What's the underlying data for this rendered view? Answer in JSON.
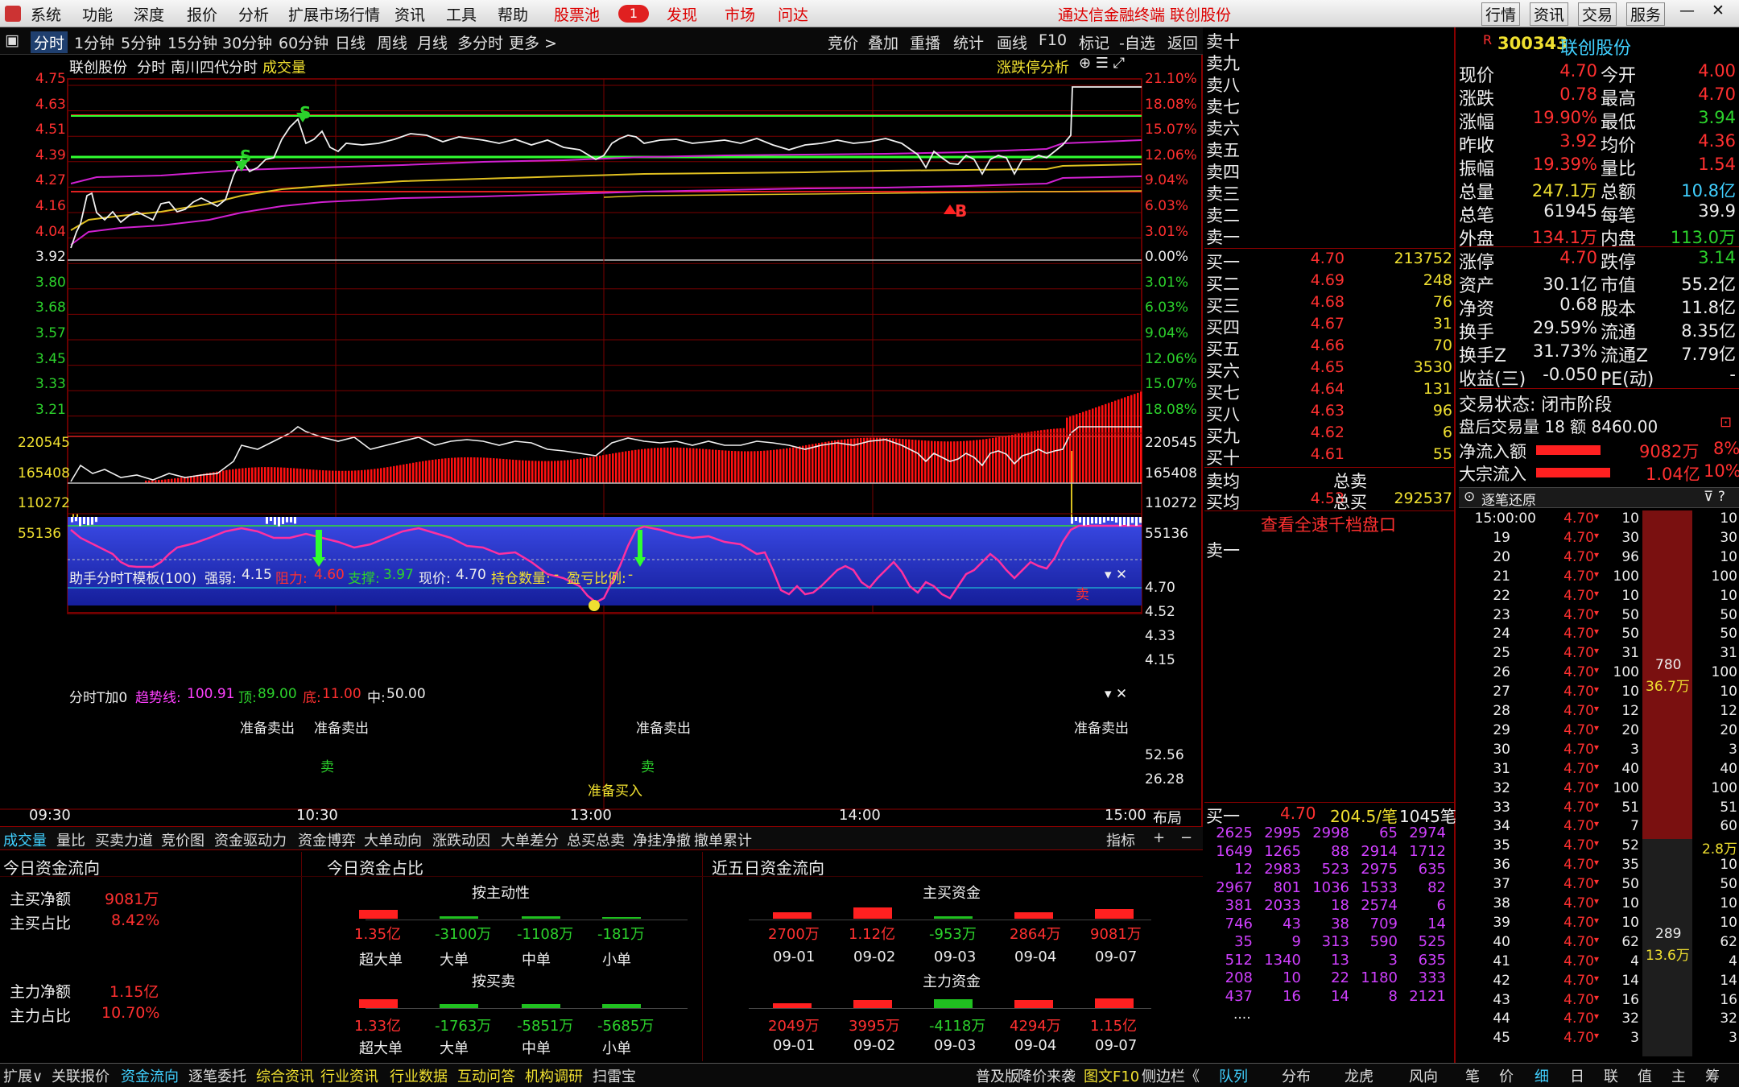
{
  "menu": {
    "items": [
      "系统",
      "功能",
      "深度",
      "报价",
      "分析",
      "扩展市场行情",
      "资讯",
      "工具",
      "帮助"
    ],
    "stock_pool": "股票池",
    "badge": "1",
    "discover": "发现",
    "market": "市场",
    "ask": "问达",
    "title": "通达信金融终端  联创股份",
    "right_tabs": [
      "行情",
      "资讯",
      "交易",
      "服务"
    ]
  },
  "periods": {
    "items": [
      "分时",
      "1分钟",
      "5分钟",
      "15分钟",
      "30分钟",
      "60分钟",
      "日线",
      "周线",
      "月线",
      "多分时",
      "更多 >"
    ],
    "tools": [
      "竞价",
      "叠加",
      "重播",
      "统计",
      "画线",
      "F10",
      "标记",
      "-自选",
      "返回"
    ]
  },
  "chart_header": {
    "name": "联创股份",
    "mode": "分时",
    "indicator": "南川四代分时",
    "volume": "成交量",
    "analysis": "涨跌停分析"
  },
  "price_axis": {
    "left": [
      "4.75",
      "4.63",
      "4.51",
      "4.39",
      "4.27",
      "4.16",
      "4.04",
      "3.92",
      "3.80",
      "3.68",
      "3.57",
      "3.45",
      "3.33",
      "3.21"
    ],
    "right": [
      "21.10%",
      "18.08%",
      "15.07%",
      "12.06%",
      "9.04%",
      "6.03%",
      "3.01%",
      "0.00%",
      "3.01%",
      "6.03%",
      "9.04%",
      "12.06%",
      "15.07%",
      "18.08%"
    ]
  },
  "volume_axis": [
    "220545",
    "165408",
    "110272",
    "55136"
  ],
  "markers": {
    "s1": "S",
    "s2": "S",
    "b": "B"
  },
  "ind1": {
    "title": "助手分时T模板(100)",
    "strength_label": "强弱:",
    "strength": "4.15",
    "resist_label": "阻力:",
    "resist": "4.60",
    "support_label": "支撑:",
    "support": "3.97",
    "price_label": "现价:",
    "price": "4.70",
    "hold_label": "持仓数量:",
    "hold": "-",
    "pnl_label": "盈亏比例:",
    "pnl": "-",
    "axis": [
      "4.70",
      "4.52",
      "4.33",
      "4.15"
    ],
    "sell": "卖"
  },
  "ind2": {
    "title": "分时T加0",
    "trend_label": "趋势线:",
    "trend": "100.91",
    "top_label": "顶:",
    "top": "89.00",
    "bottom_label": "底:",
    "bottom": "11.00",
    "mid_label": "中:",
    "mid": "50.00",
    "axis": [
      "52.56",
      "26.28"
    ],
    "prep_sell": "准备卖出",
    "prep_buy": "准备买入",
    "sell": "卖"
  },
  "time_axis": [
    "09:30",
    "10:30",
    "13:00",
    "14:00",
    "15:00"
  ],
  "layout_btn": "布局",
  "orderbook": {
    "asks": [
      "卖十",
      "卖九",
      "卖八",
      "卖七",
      "卖六",
      "卖五",
      "卖四",
      "卖三",
      "卖二",
      "卖一"
    ],
    "bids": [
      [
        "买一",
        "4.70",
        "213752"
      ],
      [
        "买二",
        "4.69",
        "248"
      ],
      [
        "买三",
        "4.68",
        "76"
      ],
      [
        "买四",
        "4.67",
        "31"
      ],
      [
        "买五",
        "4.66",
        "70"
      ],
      [
        "买六",
        "4.65",
        "3530"
      ],
      [
        "买七",
        "4.64",
        "131"
      ],
      [
        "买八",
        "4.63",
        "96"
      ],
      [
        "买九",
        "4.62",
        "6"
      ],
      [
        "买十",
        "4.61",
        "55"
      ]
    ],
    "avg_sell": "卖均",
    "total_sell": "总卖",
    "avg_buy": "买均",
    "avg_buy_val": "4.53",
    "total_buy": "总买",
    "total_buy_val": "292537",
    "fast_btn": "查看全速千档盘口",
    "sell1": "卖一",
    "buy1": "买一",
    "buy1_price": "4.70",
    "buy1_per": "204.5/笔",
    "buy1_count": "1045笔"
  },
  "queue": [
    [
      "2625",
      "2995",
      "2998",
      "65",
      "2974"
    ],
    [
      "1649",
      "1265",
      "88",
      "2914",
      "1712"
    ],
    [
      "12",
      "2983",
      "523",
      "2975",
      "635"
    ],
    [
      "2967",
      "801",
      "1036",
      "1533",
      "82"
    ],
    [
      "381",
      "2033",
      "18",
      "2574",
      "6"
    ],
    [
      "746",
      "43",
      "38",
      "709",
      "14"
    ],
    [
      "35",
      "9",
      "313",
      "590",
      "525"
    ],
    [
      "512",
      "1340",
      "13",
      "3",
      "635"
    ],
    [
      "208",
      "10",
      "22",
      "1180",
      "333"
    ],
    [
      "437",
      "16",
      "14",
      "8",
      "2121"
    ]
  ],
  "queue_more": "....",
  "quote": {
    "code": "300343",
    "name": "联创股份",
    "r": "R",
    "rows": [
      [
        "现价",
        "4.70",
        "今开",
        "4.00"
      ],
      [
        "涨跌",
        "0.78",
        "最高",
        "4.70"
      ],
      [
        "涨幅",
        "19.90%",
        "最低",
        "3.94"
      ],
      [
        "昨收",
        "3.92",
        "均价",
        "4.36"
      ],
      [
        "振幅",
        "19.39%",
        "量比",
        "1.54"
      ],
      [
        "总量",
        "247.1万",
        "总额",
        "10.8亿"
      ],
      [
        "总笔",
        "61945",
        "每笔",
        "39.9"
      ],
      [
        "外盘",
        "134.1万",
        "内盘",
        "113.0万"
      ]
    ],
    "rows2": [
      [
        "涨停",
        "4.70",
        "跌停",
        "3.14"
      ],
      [
        "资产",
        "30.1亿",
        "市值",
        "55.2亿"
      ],
      [
        "净资",
        "0.68",
        "股本",
        "11.8亿"
      ],
      [
        "换手",
        "29.59%",
        "流通",
        "8.35亿"
      ],
      [
        "换手Z",
        "31.73%",
        "流通Z",
        "7.79亿"
      ],
      [
        "收益(三)",
        "-0.050",
        "PE(动)",
        "-"
      ]
    ],
    "state": "交易状态: 闭市阶段",
    "after": "盘后交易量 18 额 8460.00",
    "netflow_label": "净流入额",
    "netflow": "9082万",
    "netflow_pct": "8%",
    "block_label": "大宗流入",
    "block": "1.04亿",
    "block_pct": "10%"
  },
  "ticks_title": "逐笔还原",
  "ticks": [
    [
      "15:00:00",
      "4.70",
      "10"
    ],
    [
      "19",
      "4.70",
      "30"
    ],
    [
      "20",
      "4.70",
      "96"
    ],
    [
      "21",
      "4.70",
      "100"
    ],
    [
      "22",
      "4.70",
      "10"
    ],
    [
      "23",
      "4.70",
      "50"
    ],
    [
      "24",
      "4.70",
      "50"
    ],
    [
      "25",
      "4.70",
      "31"
    ],
    [
      "26",
      "4.70",
      "100"
    ],
    [
      "27",
      "4.70",
      "10"
    ],
    [
      "28",
      "4.70",
      "12"
    ],
    [
      "29",
      "4.70",
      "20"
    ],
    [
      "30",
      "4.70",
      "3"
    ],
    [
      "31",
      "4.70",
      "40"
    ],
    [
      "32",
      "4.70",
      "100"
    ],
    [
      "33",
      "4.70",
      "51"
    ],
    [
      "34",
      "4.70",
      "7"
    ],
    [
      "35",
      "4.70",
      "52"
    ],
    [
      "36",
      "4.70",
      "35"
    ],
    [
      "37",
      "4.70",
      "50"
    ],
    [
      "38",
      "4.70",
      "10"
    ],
    [
      "39",
      "4.70",
      "10"
    ],
    [
      "40",
      "4.70",
      "62"
    ],
    [
      "41",
      "4.70",
      "4"
    ],
    [
      "42",
      "4.70",
      "14"
    ],
    [
      "43",
      "4.70",
      "16"
    ],
    [
      "44",
      "4.70",
      "32"
    ],
    [
      "45",
      "4.70",
      "3"
    ]
  ],
  "ticks_right": [
    "10",
    "30",
    "10",
    "100",
    "10",
    "50",
    "50",
    "31",
    "100",
    "10",
    "12",
    "20",
    "3",
    "40",
    "100",
    "51",
    "60",
    "2.8万",
    "10",
    "50",
    "10",
    "10",
    "62",
    "4",
    "14",
    "16",
    "32",
    "3"
  ],
  "tick_bar": {
    "top_num": "780",
    "top_amt": "36.7万",
    "bot_num": "289",
    "bot_amt": "13.6万"
  },
  "bottom_tabs": [
    "成交量",
    "量比",
    "买卖力道",
    "竞价图",
    "资金驱动力",
    "资金博弈",
    "大单动向",
    "涨跌动因",
    "大单差分",
    "总买总卖",
    "净挂净撤",
    "撤单累计"
  ],
  "indicator_btn": "指标",
  "funds": {
    "today_title": "今日资金流向",
    "main_net_label": "主买净额",
    "main_net": "9081万",
    "main_pct_label": "主买占比",
    "main_pct": "8.42%",
    "force_net_label": "主力净额",
    "force_net": "1.15亿",
    "force_pct_label": "主力占比",
    "force_pct": "10.70%",
    "ratio_title": "今日资金占比",
    "active_title": "按主动性",
    "active_vals": [
      "1.35亿",
      "-3100万",
      "-1108万",
      "-181万"
    ],
    "buysell_title": "按买卖",
    "buysell_vals": [
      "1.33亿",
      "-1763万",
      "-5851万",
      "-5685万"
    ],
    "size_labels": [
      "超大单",
      "大单",
      "中单",
      "小单"
    ],
    "five_title": "近五日资金流向",
    "main_title": "主买资金",
    "main_vals": [
      "2700万",
      "1.12亿",
      "-953万",
      "2864万",
      "9081万"
    ],
    "force_title": "主力资金",
    "force_vals": [
      "2049万",
      "3995万",
      "-4118万",
      "4294万",
      "1.15亿"
    ],
    "dates": [
      "09-01",
      "09-02",
      "09-03",
      "09-04",
      "09-07"
    ]
  },
  "status_left": [
    "扩展∨",
    "关联报价",
    "资金流向",
    "逐笔委托",
    "综合资讯",
    "行业资讯",
    "行业数据",
    "互动问答",
    "机构调研",
    "扫雷宝"
  ],
  "status_mid": [
    "普及版",
    "降价来袭",
    "图文F10",
    "侧边栏《"
  ],
  "status_right": [
    "队列",
    "分布",
    "龙虎",
    "风向",
    "笔",
    "价",
    "细",
    "日",
    "联",
    "值",
    "主",
    "筹"
  ]
}
